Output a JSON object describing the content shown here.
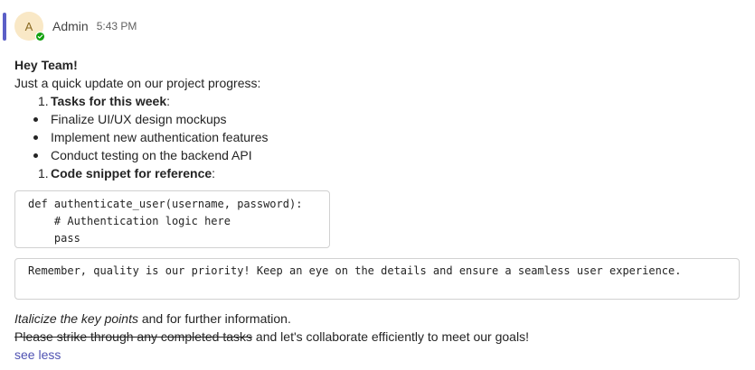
{
  "message": {
    "author": {
      "initial": "A",
      "name": "Admin",
      "time": "5:43 PM",
      "presence": "available"
    },
    "greeting": "Hey Team!",
    "intro": "Just a quick update on our project progress:",
    "list1": {
      "number": "1.",
      "bold": "Tasks for this week",
      "suffix": ":"
    },
    "bullets": [
      "Finalize UI/UX design mockups",
      "Implement new authentication features",
      "Conduct testing on the backend API"
    ],
    "list2": {
      "number": "1.",
      "bold": "Code snippet for reference",
      "suffix": ":"
    },
    "code_lines": [
      "def authenticate_user(username, password):",
      "    # Authentication logic here",
      "    pass"
    ],
    "quote": "Remember, quality is our priority! Keep an eye on the details and ensure a seamless user experience.",
    "footer1": {
      "italic": "Italicize the key points",
      "rest": " and for further information."
    },
    "footer2": {
      "strike": "Please strike through any completed tasks",
      "rest": " and let's collaborate efficiently to meet our goals!"
    },
    "see_less": "see less"
  },
  "colors": {
    "accent_bar": "#5b5fc7",
    "avatar_bg": "#f9e8c6",
    "presence": "#13a10e",
    "link": "#4f52b2"
  }
}
